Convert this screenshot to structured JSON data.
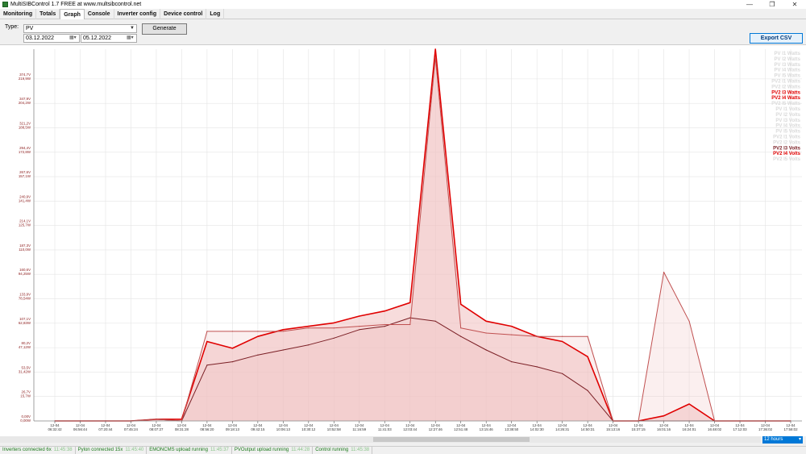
{
  "window": {
    "title": "MultiSIBControl 1.7 FREE at www.multsibcontrol.net",
    "minimize": "—",
    "maximize": "❐",
    "close": "✕"
  },
  "tabs": [
    "Monitoring",
    "Totals",
    "Graph",
    "Console",
    "Inverter config",
    "Device control",
    "Log"
  ],
  "active_tab": "Graph",
  "controls": {
    "type_label": "Type:",
    "type_value": "PV",
    "date_from": "03.12.2022",
    "date_to": "05.12.2022",
    "generate_label": "Generate",
    "export_label": "Export CSV"
  },
  "range": {
    "value": "12 hours"
  },
  "status": [
    {
      "text": "Inverters connected 6x",
      "time": "11:45:38"
    },
    {
      "text": "Pylon connected 15x",
      "time": "11:45:40"
    },
    {
      "text": "EMONCMS upload running",
      "time": "11:45:37"
    },
    {
      "text": "PVOutput upload running",
      "time": "11:44:28"
    },
    {
      "text": "Control running",
      "time": "11:45:38"
    }
  ],
  "colors": {
    "series_light": "#d9d9d9",
    "series_red": "#e00000",
    "series_darkred": "#7a1e24",
    "series_lightred": "#c05050",
    "fill": "#f0c0c0",
    "axis_text": "#8b1a1a"
  },
  "chart_data": {
    "type": "area",
    "y_ticks_volts": [
      "0,00V",
      "26,7V",
      "53,5V",
      "80,2V",
      "107,1V",
      "133,9V",
      "160,6V",
      "187,3V",
      "214,1V",
      "240,9V",
      "267,6V",
      "294,4V",
      "321,2V",
      "347,9V",
      "374,7V"
    ],
    "y_ticks_watts": [
      "0,00W",
      "15,7W",
      "31,42W",
      "47,12W",
      "62,83W",
      "78,54W",
      "94,25W",
      "110,0W",
      "125,7W",
      "141,4W",
      "157,1W",
      "172,8W",
      "188,5W",
      "204,2W",
      "219,9W"
    ],
    "x_ticks": [
      {
        "date": "12-04",
        "time": "06:32:42"
      },
      {
        "date": "12-04",
        "time": "06:56:44"
      },
      {
        "date": "12-04",
        "time": "07:20:44"
      },
      {
        "date": "12-04",
        "time": "07:45:24"
      },
      {
        "date": "12-04",
        "time": "08:07:27"
      },
      {
        "date": "12-04",
        "time": "08:31:28"
      },
      {
        "date": "12-04",
        "time": "08:56:20"
      },
      {
        "date": "12-04",
        "time": "09:18:13"
      },
      {
        "date": "12-04",
        "time": "09:42:15"
      },
      {
        "date": "12-04",
        "time": "10:06:13"
      },
      {
        "date": "12-04",
        "time": "10:30:12"
      },
      {
        "date": "12-04",
        "time": "10:52:58"
      },
      {
        "date": "12-04",
        "time": "11:16:59"
      },
      {
        "date": "12-04",
        "time": "11:41:03"
      },
      {
        "date": "12-04",
        "time": "12:03:44"
      },
      {
        "date": "12-04",
        "time": "12:27:46"
      },
      {
        "date": "12-04",
        "time": "12:51:48"
      },
      {
        "date": "12-04",
        "time": "13:15:46"
      },
      {
        "date": "12-04",
        "time": "13:38:50"
      },
      {
        "date": "12-04",
        "time": "14:02:30"
      },
      {
        "date": "12-04",
        "time": "14:26:31"
      },
      {
        "date": "12-04",
        "time": "14:50:31"
      },
      {
        "date": "12-04",
        "time": "15:13:16"
      },
      {
        "date": "12-04",
        "time": "15:37:15"
      },
      {
        "date": "12-04",
        "time": "16:01:16"
      },
      {
        "date": "12-04",
        "time": "16:24:01"
      },
      {
        "date": "12-04",
        "time": "16:48:02"
      },
      {
        "date": "12-04",
        "time": "17:12:03"
      },
      {
        "date": "12-04",
        "time": "17:36:02"
      },
      {
        "date": "12-04",
        "time": "17:58:02"
      }
    ],
    "ylim_watts": [
      0,
      219.9
    ],
    "grid": true,
    "legend_position": "top-right",
    "legend": [
      {
        "name": "PV I1 Watts",
        "style": "light"
      },
      {
        "name": "PV I2 Watts",
        "style": "light"
      },
      {
        "name": "PV I3 Watts",
        "style": "light"
      },
      {
        "name": "PV I4 Watts",
        "style": "light"
      },
      {
        "name": "PV I5 Watts",
        "style": "light"
      },
      {
        "name": "PV2 I1 Watts",
        "style": "light"
      },
      {
        "name": "PV2 I2 Watts",
        "style": "light"
      },
      {
        "name": "PV2 I3 Watts",
        "style": "red"
      },
      {
        "name": "PV2 I4 Watts",
        "style": "red"
      },
      {
        "name": "PV2 I5 Watts",
        "style": "light"
      },
      {
        "name": "PV I1 Volts",
        "style": "light"
      },
      {
        "name": "PV I2 Volts",
        "style": "light"
      },
      {
        "name": "PV I3 Volts",
        "style": "light"
      },
      {
        "name": "PV I4 Volts",
        "style": "light"
      },
      {
        "name": "PV I5 Volts",
        "style": "light"
      },
      {
        "name": "PV2 I1 Volts",
        "style": "light"
      },
      {
        "name": "PV2 I2 Volts",
        "style": "light"
      },
      {
        "name": "PV2 I3 Volts",
        "style": "darkred"
      },
      {
        "name": "PV2 I4 Volts",
        "style": "red"
      },
      {
        "name": "PV2 I5 Volts",
        "style": "light"
      }
    ],
    "series": [
      {
        "name": "PV2 I4 Watts",
        "color": "#e00000",
        "values": [
          0,
          0,
          0,
          0,
          1,
          1,
          47,
          43,
          50,
          54,
          56,
          58,
          62,
          65,
          70,
          220,
          69,
          59,
          56,
          50,
          47,
          38,
          0,
          0,
          3,
          10,
          0,
          0,
          0,
          0
        ]
      },
      {
        "name": "PV2 I3 Volts",
        "color": "#7a1e24",
        "values": [
          0,
          0,
          0,
          0,
          1,
          0,
          33,
          35,
          39,
          42,
          45,
          49,
          54,
          56,
          61,
          59,
          50,
          42,
          35,
          32,
          28,
          18,
          0,
          0,
          0,
          0,
          0,
          0,
          0,
          0
        ]
      },
      {
        "name": "PV2 I4 Volts",
        "color": "#c05050",
        "values": [
          0,
          0,
          0,
          0,
          1,
          0,
          53,
          53,
          53,
          53,
          55,
          55,
          56,
          57,
          57,
          215,
          55,
          52,
          51,
          50,
          50,
          50,
          0,
          0,
          88,
          59,
          0,
          0,
          0,
          0
        ]
      }
    ]
  }
}
